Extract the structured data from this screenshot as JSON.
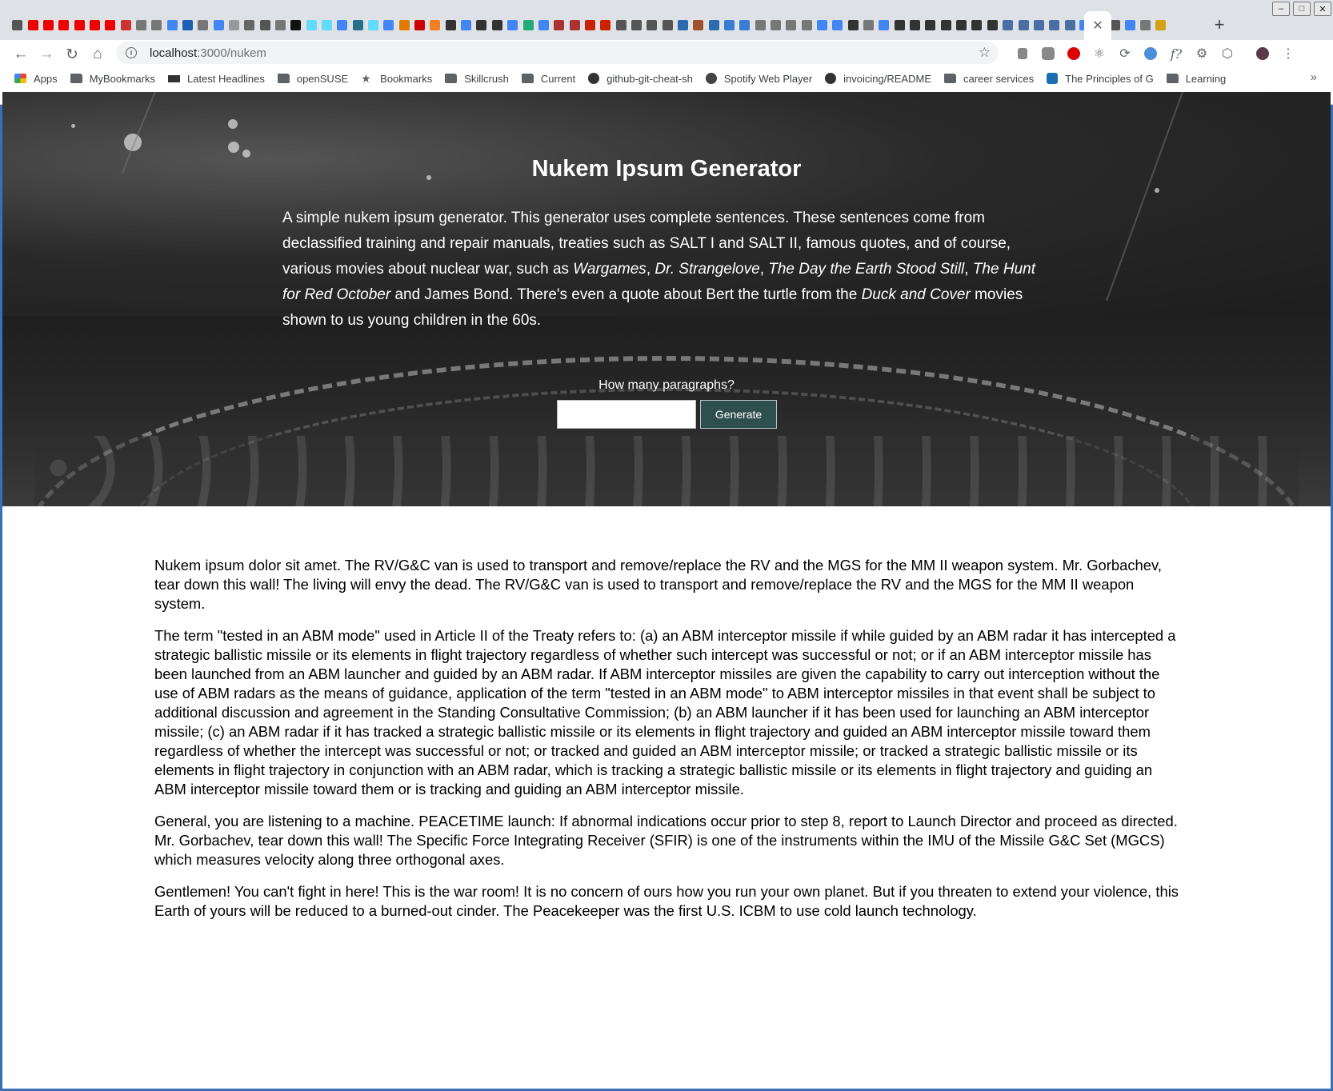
{
  "browser": {
    "url_host": "localhost",
    "url_path": ":3000/nukem",
    "tab_close": "✕",
    "new_tab": "+",
    "window_controls": [
      "–",
      "□",
      "✕"
    ],
    "bookmarks": [
      {
        "label": "Apps",
        "icon": "apps-icon"
      },
      {
        "label": "MyBookmarks",
        "icon": "folder-icon"
      },
      {
        "label": "Latest Headlines",
        "icon": "bbc-icon"
      },
      {
        "label": "openSUSE",
        "icon": "folder-icon"
      },
      {
        "label": "Bookmarks",
        "icon": "star-icon"
      },
      {
        "label": "Skillcrush",
        "icon": "folder-icon"
      },
      {
        "label": "Current",
        "icon": "folder-icon"
      },
      {
        "label": "github-git-cheat-sh",
        "icon": "github-icon"
      },
      {
        "label": "Spotify Web Player",
        "icon": "spotify-icon"
      },
      {
        "label": "invoicing/README",
        "icon": "github-icon"
      },
      {
        "label": "career services",
        "icon": "folder-icon"
      },
      {
        "label": "The Principles of G",
        "icon": "globe-icon"
      },
      {
        "label": "Learning",
        "icon": "folder-icon"
      }
    ],
    "bookmarks_more": "»"
  },
  "hero": {
    "title": "Nukem Ipsum Generator",
    "desc": {
      "t1": "A simple nukem ipsum generator. This generator uses complete sentences. These sentences come from declassified training and repair manuals, treaties such as SALT I and SALT II, famous quotes, and of course, various movies about nuclear war, such as ",
      "m1": "Wargames",
      "t2": ", ",
      "m2": "Dr. Strangelove",
      "t3": ", ",
      "m3": "The Day the Earth Stood Still",
      "t4": ", ",
      "m4": "The Hunt for Red October",
      "t5": " and James Bond. There's even a quote about Bert the turtle from the ",
      "m5": "Duck and Cover",
      "t6": " movies shown to us young children in the 60s."
    },
    "form_label": "How many paragraphs?",
    "input_value": "",
    "button_label": "Generate"
  },
  "output": {
    "paragraphs": [
      "Nukem ipsum dolor sit amet. The RV/G&C van is used to transport and remove/replace the RV and the MGS for the MM II weapon system. Mr. Gorbachev, tear down this wall! The living will envy the dead. The RV/G&C van is used to transport and remove/replace the RV and the MGS for the MM II weapon system.",
      "The term \"tested in an ABM mode\" used in Article II of the Treaty refers to: (a) an ABM interceptor missile if while guided by an ABM radar it has intercepted a strategic ballistic missile or its elements in flight trajectory regardless of whether such intercept was successful or not; or if an ABM interceptor missile has been launched from an ABM launcher and guided by an ABM radar. If ABM interceptor missiles are given the capability to carry out interception without the use of ABM radars as the means of guidance, application of the term \"tested in an ABM mode\" to ABM interceptor missiles in that event shall be subject to additional discussion and agreement in the Standing Consultative Commission; (b) an ABM launcher if it has been used for launching an ABM interceptor missile; (c) an ABM radar if it has tracked a strategic ballistic missile or its elements in flight trajectory and guided an ABM interceptor missile toward them regardless of whether the intercept was successful or not; or tracked and guided an ABM interceptor missile; or tracked a strategic ballistic missile or its elements in flight trajectory in conjunction with an ABM radar, which is tracking a strategic ballistic missile or its elements in flight trajectory and guiding an ABM interceptor missile toward them or is tracking and guiding an ABM interceptor missile.",
      "General, you are listening to a machine. PEACETIME launch: If abnormal indications occur prior to step 8, report to Launch Director and proceed as directed. Mr. Gorbachev, tear down this wall! The Specific Force Integrating Receiver (SFIR) is one of the instruments within the IMU of the Missile G&C Set (MGCS) which measures velocity along three orthogonal axes.",
      "Gentlemen! You can't fight in here! This is the war room! It is no concern of ours how you run your own planet. But if you threaten to extend your violence, this Earth of yours will be reduced to a burned-out cinder. The Peacekeeper was the first U.S. ICBM to use cold launch technology."
    ]
  }
}
